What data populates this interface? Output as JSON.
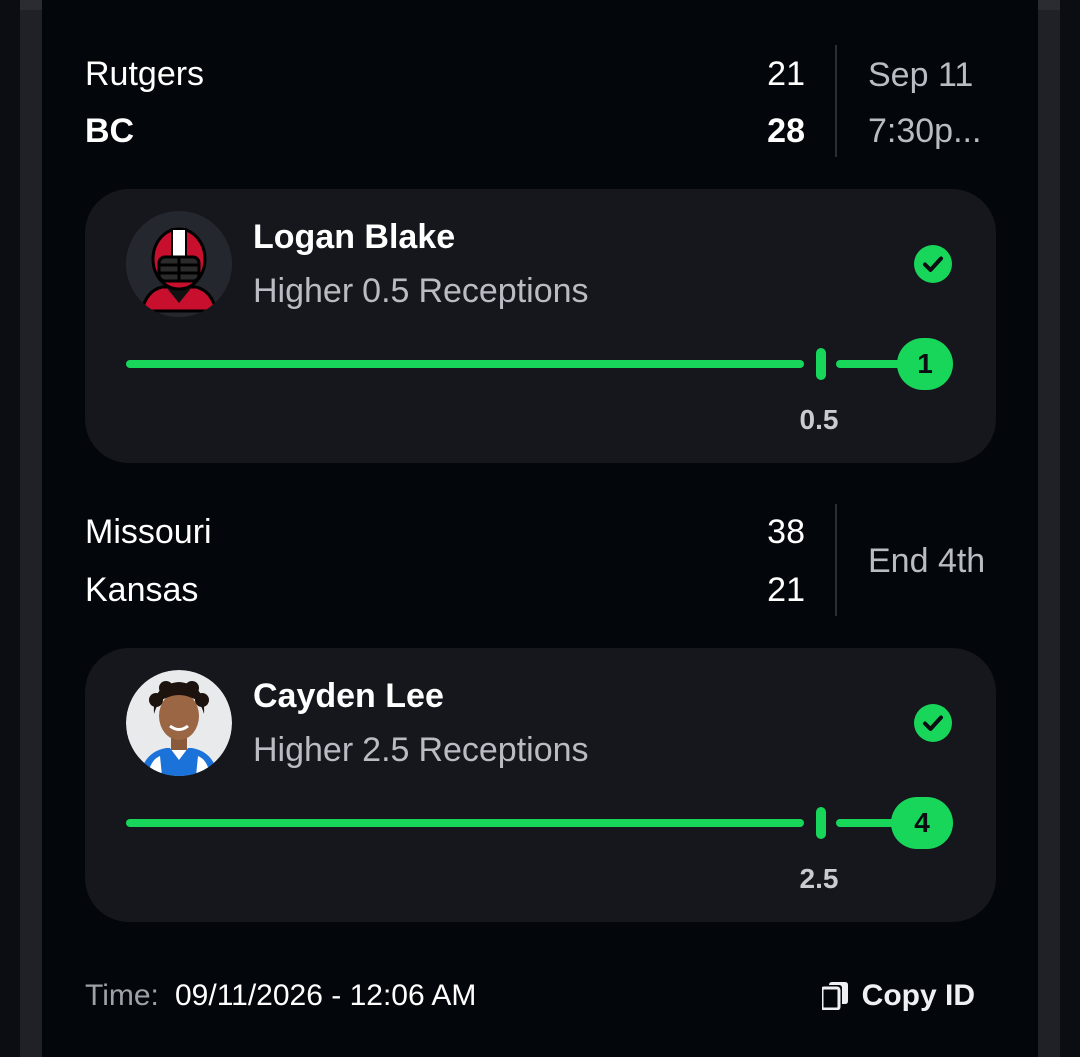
{
  "games": [
    {
      "teams": [
        {
          "name": "Rutgers",
          "score": "21",
          "winner": false
        },
        {
          "name": "BC",
          "score": "28",
          "winner": true
        }
      ],
      "status_line1": "Sep 11",
      "status_line2": "7:30p..."
    },
    {
      "teams": [
        {
          "name": "Missouri",
          "score": "38",
          "winner": false
        },
        {
          "name": "Kansas",
          "score": "21",
          "winner": false
        }
      ],
      "status_line1": "End 4th"
    }
  ],
  "picks": [
    {
      "player": "Logan Blake",
      "direction": "Higher",
      "line": "0.5",
      "stat": "Receptions",
      "result": "1",
      "line_label": "0.5",
      "status_icon": "check-circle-icon",
      "avatar_icon": "helmet-placeholder-icon"
    },
    {
      "player": "Cayden Lee",
      "direction": "Higher",
      "line": "2.5",
      "stat": "Receptions",
      "result": "4",
      "line_label": "2.5",
      "status_icon": "check-circle-icon",
      "avatar_icon": "player-photo"
    }
  ],
  "footer": {
    "time_label": "Time:",
    "time_value": "09/11/2026 - 12:06 AM",
    "copy_label": "Copy ID",
    "copy_icon": "copy-icon"
  },
  "colors": {
    "accent_green": "#18d65a",
    "background": "#03060b",
    "card": "#15171c",
    "muted_text": "#b9bcc2"
  }
}
